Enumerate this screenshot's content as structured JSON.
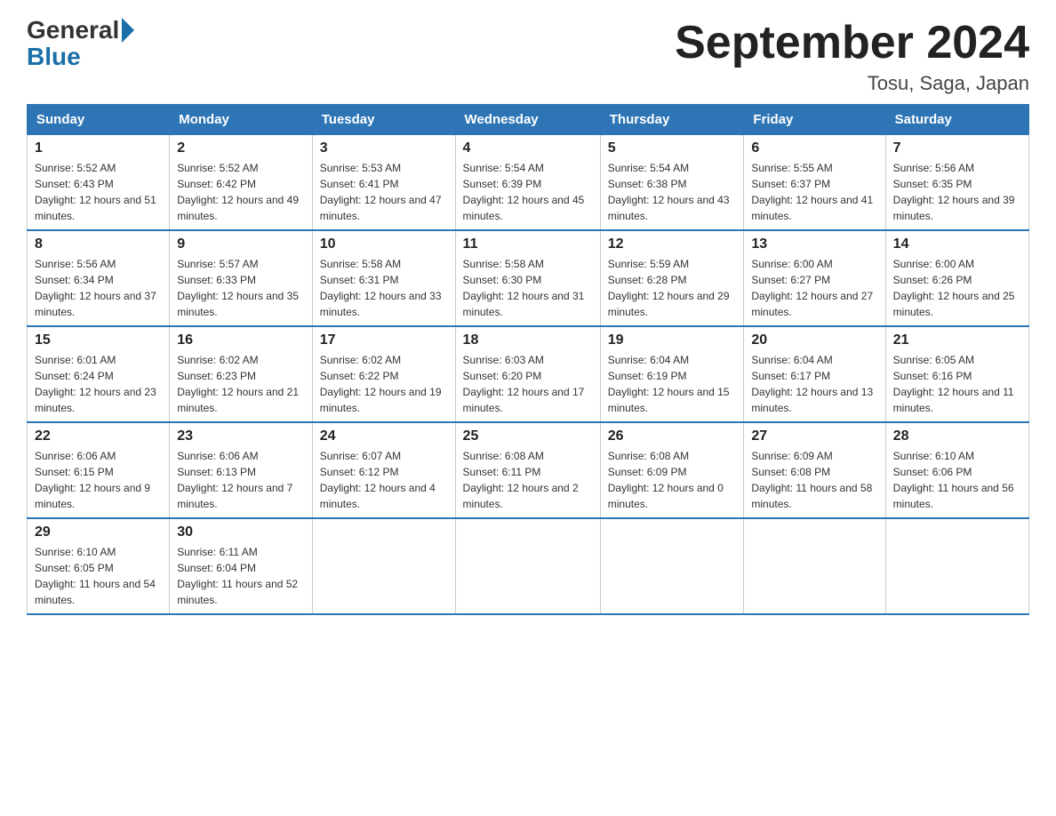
{
  "header": {
    "logo_text_general": "General",
    "logo_text_blue": "Blue",
    "month_title": "September 2024",
    "location": "Tosu, Saga, Japan"
  },
  "days_of_week": [
    "Sunday",
    "Monday",
    "Tuesday",
    "Wednesday",
    "Thursday",
    "Friday",
    "Saturday"
  ],
  "weeks": [
    [
      {
        "day": "1",
        "sunrise": "5:52 AM",
        "sunset": "6:43 PM",
        "daylight": "12 hours and 51 minutes."
      },
      {
        "day": "2",
        "sunrise": "5:52 AM",
        "sunset": "6:42 PM",
        "daylight": "12 hours and 49 minutes."
      },
      {
        "day": "3",
        "sunrise": "5:53 AM",
        "sunset": "6:41 PM",
        "daylight": "12 hours and 47 minutes."
      },
      {
        "day": "4",
        "sunrise": "5:54 AM",
        "sunset": "6:39 PM",
        "daylight": "12 hours and 45 minutes."
      },
      {
        "day": "5",
        "sunrise": "5:54 AM",
        "sunset": "6:38 PM",
        "daylight": "12 hours and 43 minutes."
      },
      {
        "day": "6",
        "sunrise": "5:55 AM",
        "sunset": "6:37 PM",
        "daylight": "12 hours and 41 minutes."
      },
      {
        "day": "7",
        "sunrise": "5:56 AM",
        "sunset": "6:35 PM",
        "daylight": "12 hours and 39 minutes."
      }
    ],
    [
      {
        "day": "8",
        "sunrise": "5:56 AM",
        "sunset": "6:34 PM",
        "daylight": "12 hours and 37 minutes."
      },
      {
        "day": "9",
        "sunrise": "5:57 AM",
        "sunset": "6:33 PM",
        "daylight": "12 hours and 35 minutes."
      },
      {
        "day": "10",
        "sunrise": "5:58 AM",
        "sunset": "6:31 PM",
        "daylight": "12 hours and 33 minutes."
      },
      {
        "day": "11",
        "sunrise": "5:58 AM",
        "sunset": "6:30 PM",
        "daylight": "12 hours and 31 minutes."
      },
      {
        "day": "12",
        "sunrise": "5:59 AM",
        "sunset": "6:28 PM",
        "daylight": "12 hours and 29 minutes."
      },
      {
        "day": "13",
        "sunrise": "6:00 AM",
        "sunset": "6:27 PM",
        "daylight": "12 hours and 27 minutes."
      },
      {
        "day": "14",
        "sunrise": "6:00 AM",
        "sunset": "6:26 PM",
        "daylight": "12 hours and 25 minutes."
      }
    ],
    [
      {
        "day": "15",
        "sunrise": "6:01 AM",
        "sunset": "6:24 PM",
        "daylight": "12 hours and 23 minutes."
      },
      {
        "day": "16",
        "sunrise": "6:02 AM",
        "sunset": "6:23 PM",
        "daylight": "12 hours and 21 minutes."
      },
      {
        "day": "17",
        "sunrise": "6:02 AM",
        "sunset": "6:22 PM",
        "daylight": "12 hours and 19 minutes."
      },
      {
        "day": "18",
        "sunrise": "6:03 AM",
        "sunset": "6:20 PM",
        "daylight": "12 hours and 17 minutes."
      },
      {
        "day": "19",
        "sunrise": "6:04 AM",
        "sunset": "6:19 PM",
        "daylight": "12 hours and 15 minutes."
      },
      {
        "day": "20",
        "sunrise": "6:04 AM",
        "sunset": "6:17 PM",
        "daylight": "12 hours and 13 minutes."
      },
      {
        "day": "21",
        "sunrise": "6:05 AM",
        "sunset": "6:16 PM",
        "daylight": "12 hours and 11 minutes."
      }
    ],
    [
      {
        "day": "22",
        "sunrise": "6:06 AM",
        "sunset": "6:15 PM",
        "daylight": "12 hours and 9 minutes."
      },
      {
        "day": "23",
        "sunrise": "6:06 AM",
        "sunset": "6:13 PM",
        "daylight": "12 hours and 7 minutes."
      },
      {
        "day": "24",
        "sunrise": "6:07 AM",
        "sunset": "6:12 PM",
        "daylight": "12 hours and 4 minutes."
      },
      {
        "day": "25",
        "sunrise": "6:08 AM",
        "sunset": "6:11 PM",
        "daylight": "12 hours and 2 minutes."
      },
      {
        "day": "26",
        "sunrise": "6:08 AM",
        "sunset": "6:09 PM",
        "daylight": "12 hours and 0 minutes."
      },
      {
        "day": "27",
        "sunrise": "6:09 AM",
        "sunset": "6:08 PM",
        "daylight": "11 hours and 58 minutes."
      },
      {
        "day": "28",
        "sunrise": "6:10 AM",
        "sunset": "6:06 PM",
        "daylight": "11 hours and 56 minutes."
      }
    ],
    [
      {
        "day": "29",
        "sunrise": "6:10 AM",
        "sunset": "6:05 PM",
        "daylight": "11 hours and 54 minutes."
      },
      {
        "day": "30",
        "sunrise": "6:11 AM",
        "sunset": "6:04 PM",
        "daylight": "11 hours and 52 minutes."
      },
      null,
      null,
      null,
      null,
      null
    ]
  ]
}
